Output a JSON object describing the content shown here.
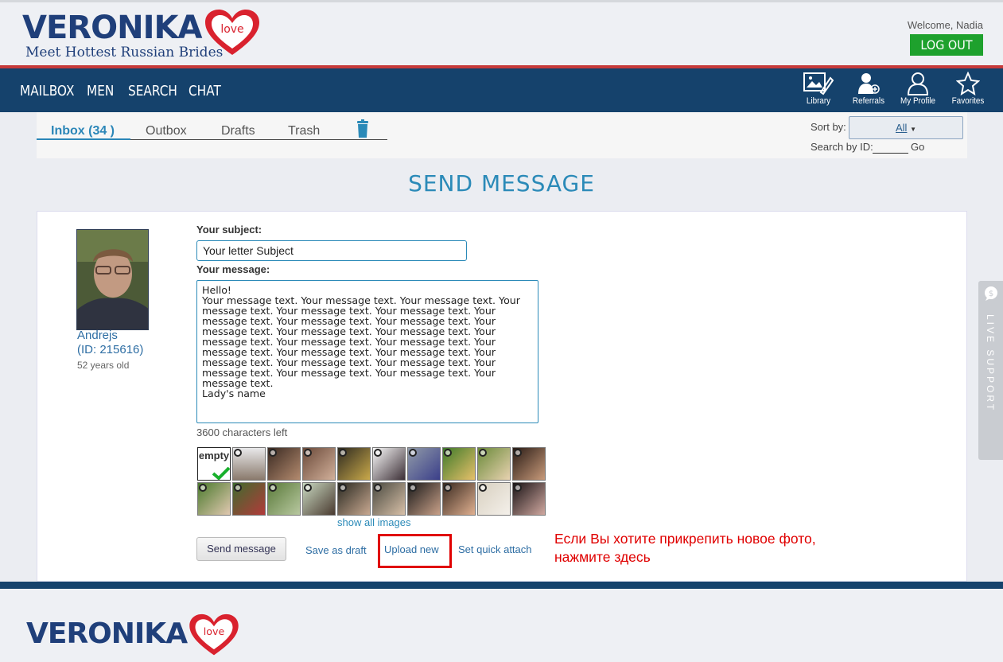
{
  "header": {
    "logo_text": "VERONIKA",
    "logo_love": "love",
    "tagline": "Meet Hottest Russian Brides",
    "welcome": "Welcome, Nadia",
    "logout": "LOG OUT"
  },
  "nav": {
    "items": [
      "MAILBOX",
      "MEN",
      "SEARCH",
      "CHAT"
    ],
    "icons": [
      {
        "label": "Library",
        "icon": "library-icon"
      },
      {
        "label": "Referrals",
        "icon": "referrals-icon"
      },
      {
        "label": "My Profile",
        "icon": "profile-icon"
      },
      {
        "label": "Favorites",
        "icon": "favorites-icon"
      }
    ]
  },
  "mailbox": {
    "tabs": [
      "Inbox (34 )",
      "Outbox",
      "Drafts",
      "Trash"
    ],
    "active_tab": "Inbox (34 )",
    "sort_label": "Sort by:",
    "sort_value": "All",
    "search_label": "Search by ID:",
    "search_go": "Go"
  },
  "page_title": "SEND MESSAGE",
  "recipient": {
    "name": "Andrejs",
    "id": "(ID: 215616)",
    "age": "52 years old"
  },
  "form": {
    "subject_label": "Your subject:",
    "subject_value": "Your letter Subject",
    "message_label": "Your message:",
    "message_value": "Hello!\nYour message text. Your message text. Your message text. Your message text. Your message text. Your message text. Your message text. Your message text. Your message text. Your message text. Your message text. Your message text. Your message text. Your message text. Your message text. Your message text. Your message text. Your message text. Your message text. Your message text. Your message text. Your message text. Your message text. Your message text. Your message text.\nLady's name",
    "chars_left": "3600 characters left",
    "empty_label": "empty",
    "show_all": "show all images",
    "send_button": "Send message",
    "save_draft": "Save as draft",
    "upload_new": "Upload new",
    "quick_attach": "Set quick attach"
  },
  "annotation": {
    "line1": "Если Вы хотите прикрепить новое фото,",
    "line2": "нажмите здесь"
  },
  "live_support": "LIVE SUPPORT",
  "colors": {
    "nav_bg": "#15426c",
    "accent": "#2b8ab8",
    "logout_bg": "#1ea12d",
    "annotation": "#e00000",
    "brand_red": "#d9222e"
  }
}
